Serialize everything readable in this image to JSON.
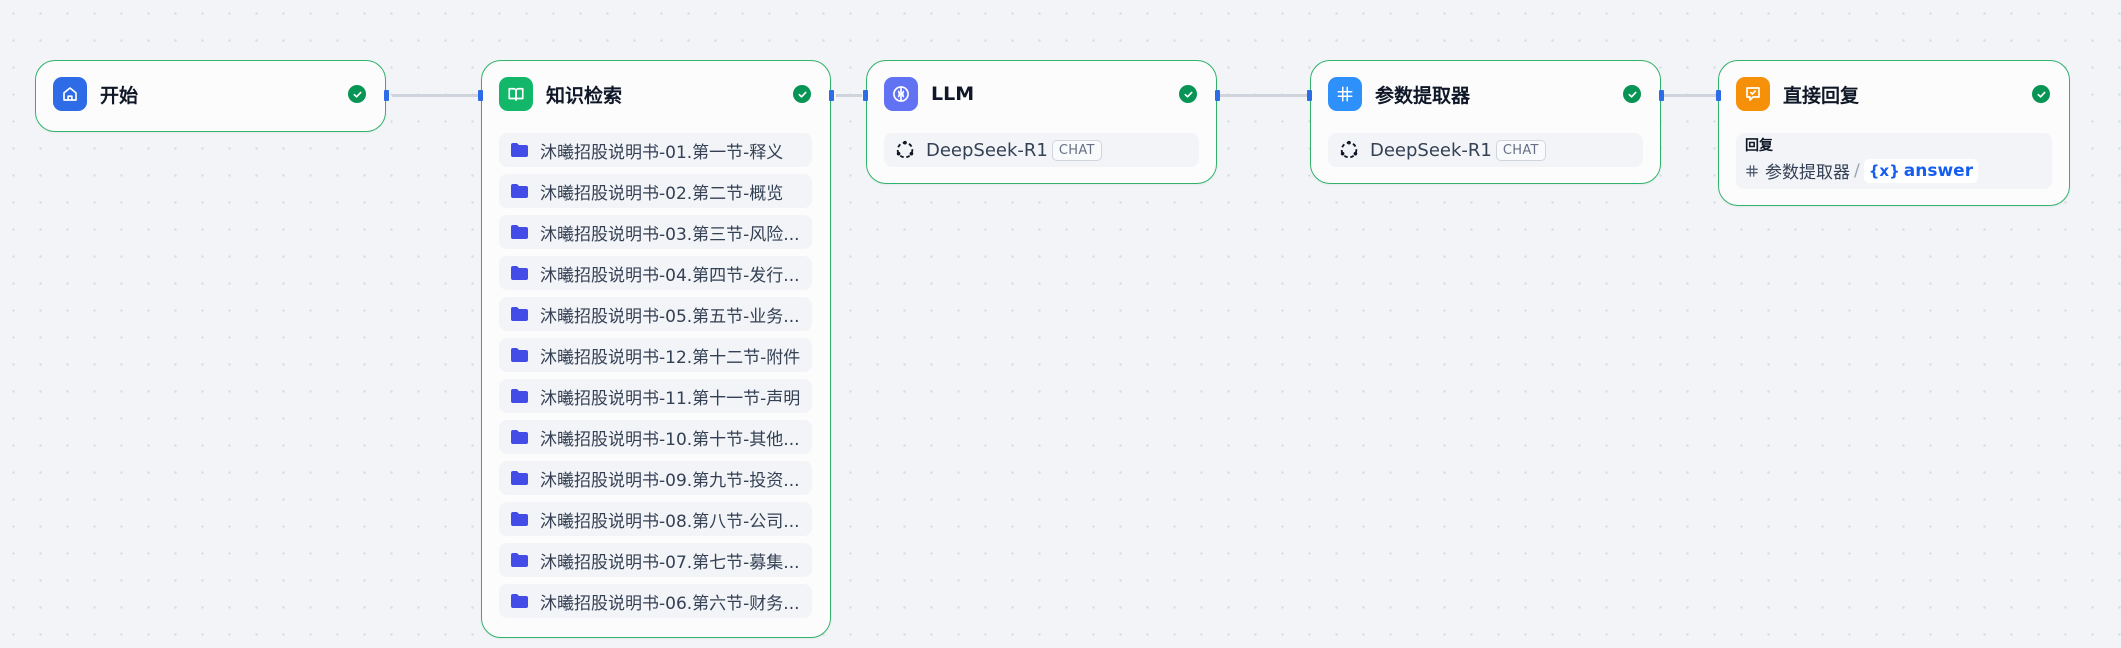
{
  "workflow": {
    "nodes": {
      "start": {
        "title": "开始"
      },
      "knowledge": {
        "title": "知识检索",
        "datasets": [
          "沐曦招股说明书-01.第一节-释义",
          "沐曦招股说明书-02.第二节-概览",
          "沐曦招股说明书-03.第三节-风险...",
          "沐曦招股说明书-04.第四节-发行...",
          "沐曦招股说明书-05.第五节-业务...",
          "沐曦招股说明书-12.第十二节-附件",
          "沐曦招股说明书-11.第十一节-声明",
          "沐曦招股说明书-10.第十节-其他...",
          "沐曦招股说明书-09.第九节-投资...",
          "沐曦招股说明书-08.第八节-公司...",
          "沐曦招股说明书-07.第七节-募集...",
          "沐曦招股说明书-06.第六节-财务..."
        ]
      },
      "llm": {
        "title": "LLM",
        "model": "DeepSeek-R1",
        "mode": "CHAT"
      },
      "param_extractor": {
        "title": "参数提取器",
        "model": "DeepSeek-R1",
        "mode": "CHAT"
      },
      "answer": {
        "title": "直接回复",
        "field_label": "回复",
        "var_source": "参数提取器",
        "var_separator": "/",
        "var_prefix": "{x}",
        "var_name": "answer"
      }
    },
    "colors": {
      "start_icon": "#2e6be6",
      "knowledge_icon": "#12b76a",
      "llm_icon": "#6172f3",
      "param_icon": "#2e90fa",
      "answer_icon": "#f79009",
      "node_border": "#31b36b",
      "success": "#079455"
    }
  }
}
